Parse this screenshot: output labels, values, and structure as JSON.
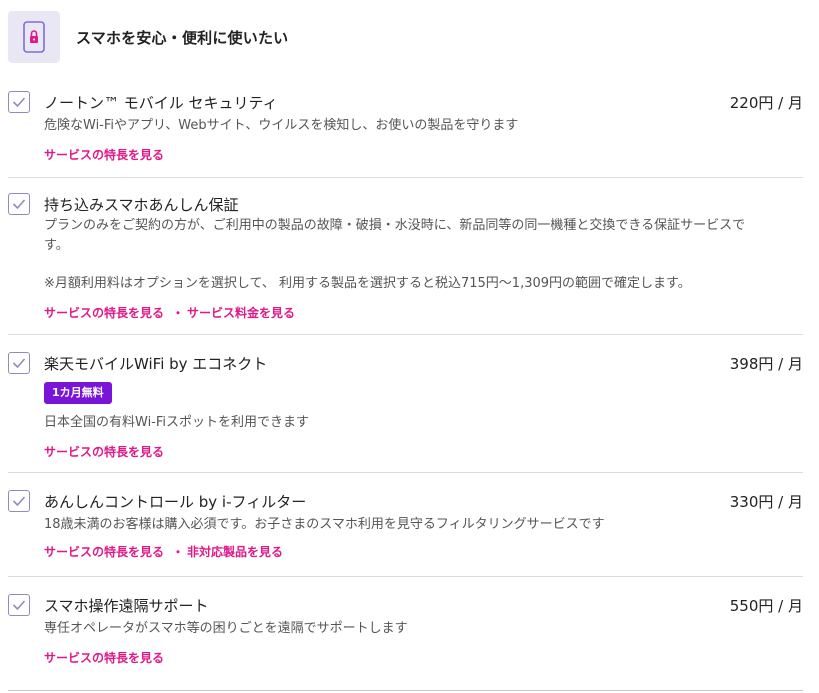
{
  "header": {
    "title": "スマホを安心・便利に使いたい",
    "icon": "smartphone-lock-icon"
  },
  "colors": {
    "accent_link": "#e0198a",
    "badge_bg": "#7a14d9",
    "checkbox_border": "#8f8abf",
    "header_icon_bg": "#e9e7f3"
  },
  "items": [
    {
      "name": "ノートン™ モバイル セキュリティ",
      "price": "220円 / 月",
      "desc": "危険なWi-Fiやアプリ、Webサイト、ウイルスを検知し、お使いの製品を守ります",
      "link1": "サービスの特長を見る",
      "checked": true
    },
    {
      "name": "持ち込みスマホあんしん保証",
      "desc_line1": "プランのみをご契約の方が、ご利用中の製品の故障・破損・水没時に、新品同等の同一機種と交換できる保証サービスで",
      "desc_line2": "す。",
      "note": "※月額利用料はオプションを選択して、 利用する製品を選択すると税込715円～1,309円の範囲で確定します。",
      "link1": "サービスの特長を見る",
      "link2": "サービス料金を見る",
      "checked": true
    },
    {
      "name": "楽天モバイルWiFi by エコネクト",
      "price": "398円 / 月",
      "badge": "1カ月無料",
      "desc": "日本全国の有料Wi-Fiスポットを利用できます",
      "link1": "サービスの特長を見る",
      "checked": true
    },
    {
      "name": "あんしんコントロール by i-フィルター",
      "price": "330円 / 月",
      "desc": "18歳未満のお客様は購入必須です。お子さまのスマホ利用を見守るフィルタリングサービスです",
      "link1": "サービスの特長を見る",
      "link2": "非対応製品を見る",
      "checked": true
    },
    {
      "name": "スマホ操作遠隔サポート",
      "price": "550円 / 月",
      "desc": "専任オペレータがスマホ等の困りごとを遠隔でサポートします",
      "link1": "サービスの特長を見る",
      "checked": true
    }
  ]
}
